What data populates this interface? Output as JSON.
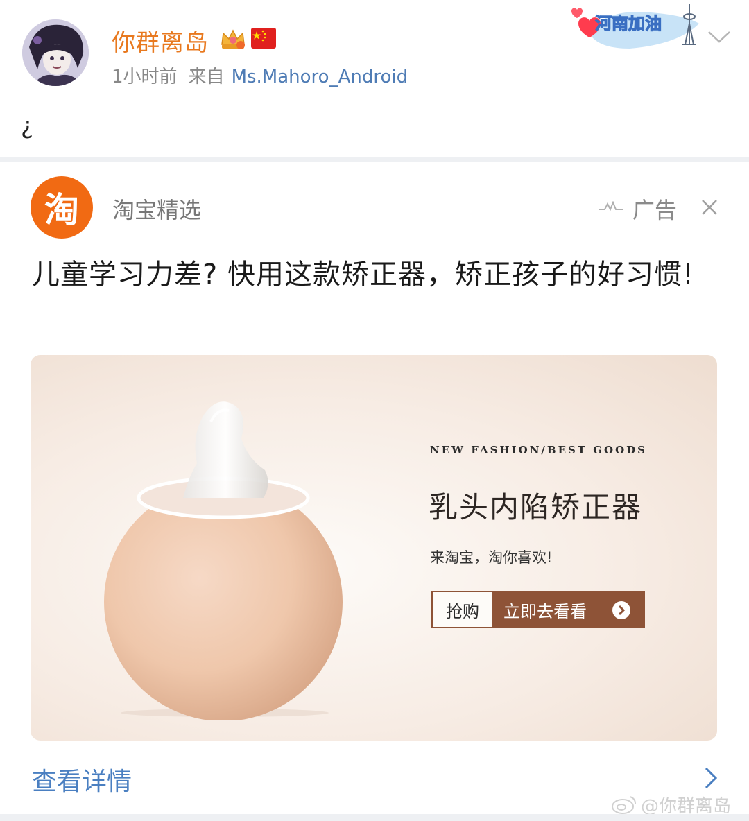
{
  "post": {
    "username": "你群离岛",
    "time": "1小时前",
    "source_prefix": "来自",
    "source": "Ms.Mahoro_Android",
    "text": "¿",
    "sticker_text": "河南加油"
  },
  "ad": {
    "source_name": "淘宝精选",
    "logo_text": "淘",
    "label": "广告",
    "title": "儿童学习力差? 快用这款矫正器，矫正孩子的好习惯!",
    "banner": {
      "tagline": "NEW FASHION/BEST GOODS",
      "product_name": "乳头内陷矫正器",
      "slogan": "来淘宝，淘你喜欢!",
      "cta_left": "抢购",
      "cta_right": "立即去看看"
    },
    "details_link": "查看详情"
  },
  "watermark": "@你群离岛",
  "colors": {
    "username": "#e8791f",
    "link": "#4a7fc1",
    "taobao_orange": "#f16a13",
    "cta_brown": "#8e5337"
  }
}
